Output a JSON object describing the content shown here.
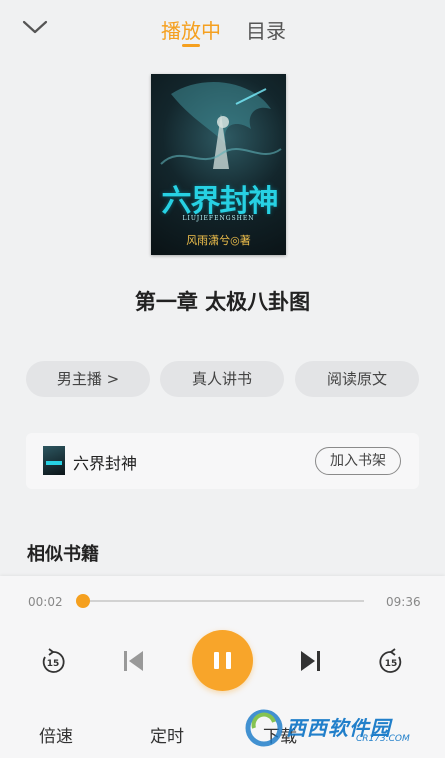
{
  "header": {
    "tabs": [
      {
        "label": "播放中",
        "active": true
      },
      {
        "label": "目录",
        "active": false
      }
    ],
    "accent_color": "#f5a01f"
  },
  "book": {
    "cover": {
      "title": "六界封神",
      "pinyin": "LIUJIEFENGSHEN",
      "author_line": "风雨潇兮◎著"
    },
    "chapter_title": "第一章 太极八卦图",
    "name": "六界封神"
  },
  "actions": {
    "narrator": "男主播 >",
    "human_reading": "真人讲书",
    "read_original": "阅读原文",
    "add_to_shelf": "加入书架"
  },
  "section": {
    "similar_books": "相似书籍"
  },
  "player": {
    "current_time": "00:02",
    "total_time": "09:36",
    "progress": 0.003,
    "rewind_seconds": "15",
    "forward_seconds": "15",
    "state": "playing",
    "speed_label": "倍速",
    "timer_label": "定时",
    "download_label": "下载"
  },
  "watermark": {
    "text": "西西软件园",
    "url": "CR173.COM"
  }
}
